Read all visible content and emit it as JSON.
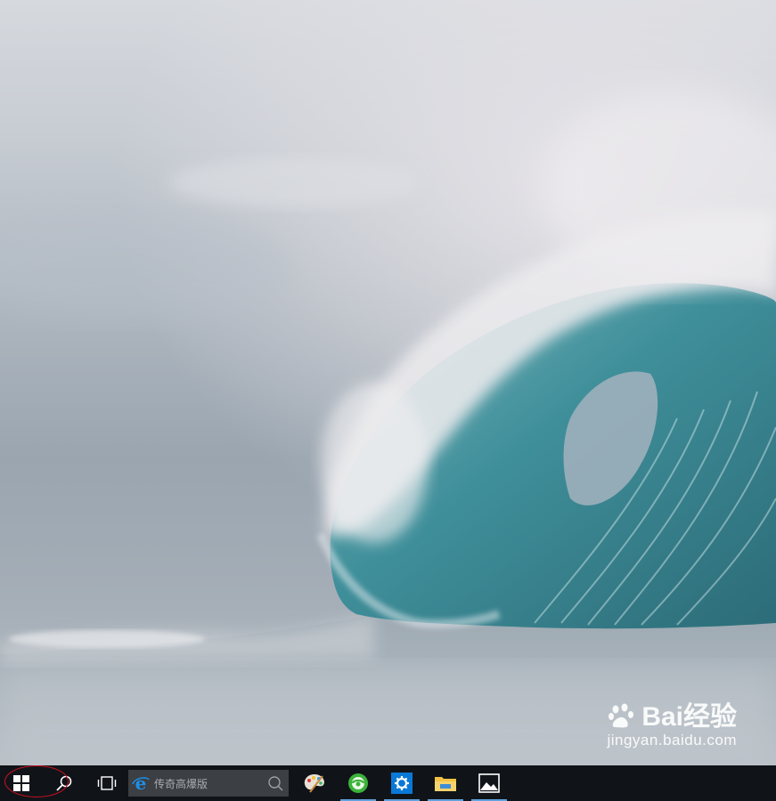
{
  "desktop": {
    "wallpaper": "stormy ocean with a large curling turquoise wave",
    "colors": {
      "sky": "#c7ccd3",
      "wave": "#3f8f9a",
      "spray": "#e8e6ea",
      "sea": "#aab3bb"
    }
  },
  "watermark": {
    "brand_left": "Bai",
    "brand_right": "经验",
    "url": "jingyan.baidu.com"
  },
  "taskbar": {
    "background": "#101419",
    "accent": "#5fa2dd",
    "start_icon": "windows-logo-icon",
    "search_icon": "search-icon",
    "taskview_icon": "task-view-icon",
    "search_box": {
      "placeholder": "传奇高爆版"
    },
    "apps": [
      {
        "name": "paint-app",
        "icon": "palette-icon",
        "active": false
      },
      {
        "name": "360-browser-app",
        "icon": "360-browser-icon",
        "active": true
      },
      {
        "name": "settings-app",
        "icon": "gear-icon",
        "active": true
      },
      {
        "name": "file-explorer-app",
        "icon": "folder-icon",
        "active": true
      },
      {
        "name": "photos-app",
        "icon": "photos-icon",
        "active": true
      }
    ]
  },
  "annotation": {
    "type": "red-ellipse-highlight",
    "color": "#d01020"
  }
}
